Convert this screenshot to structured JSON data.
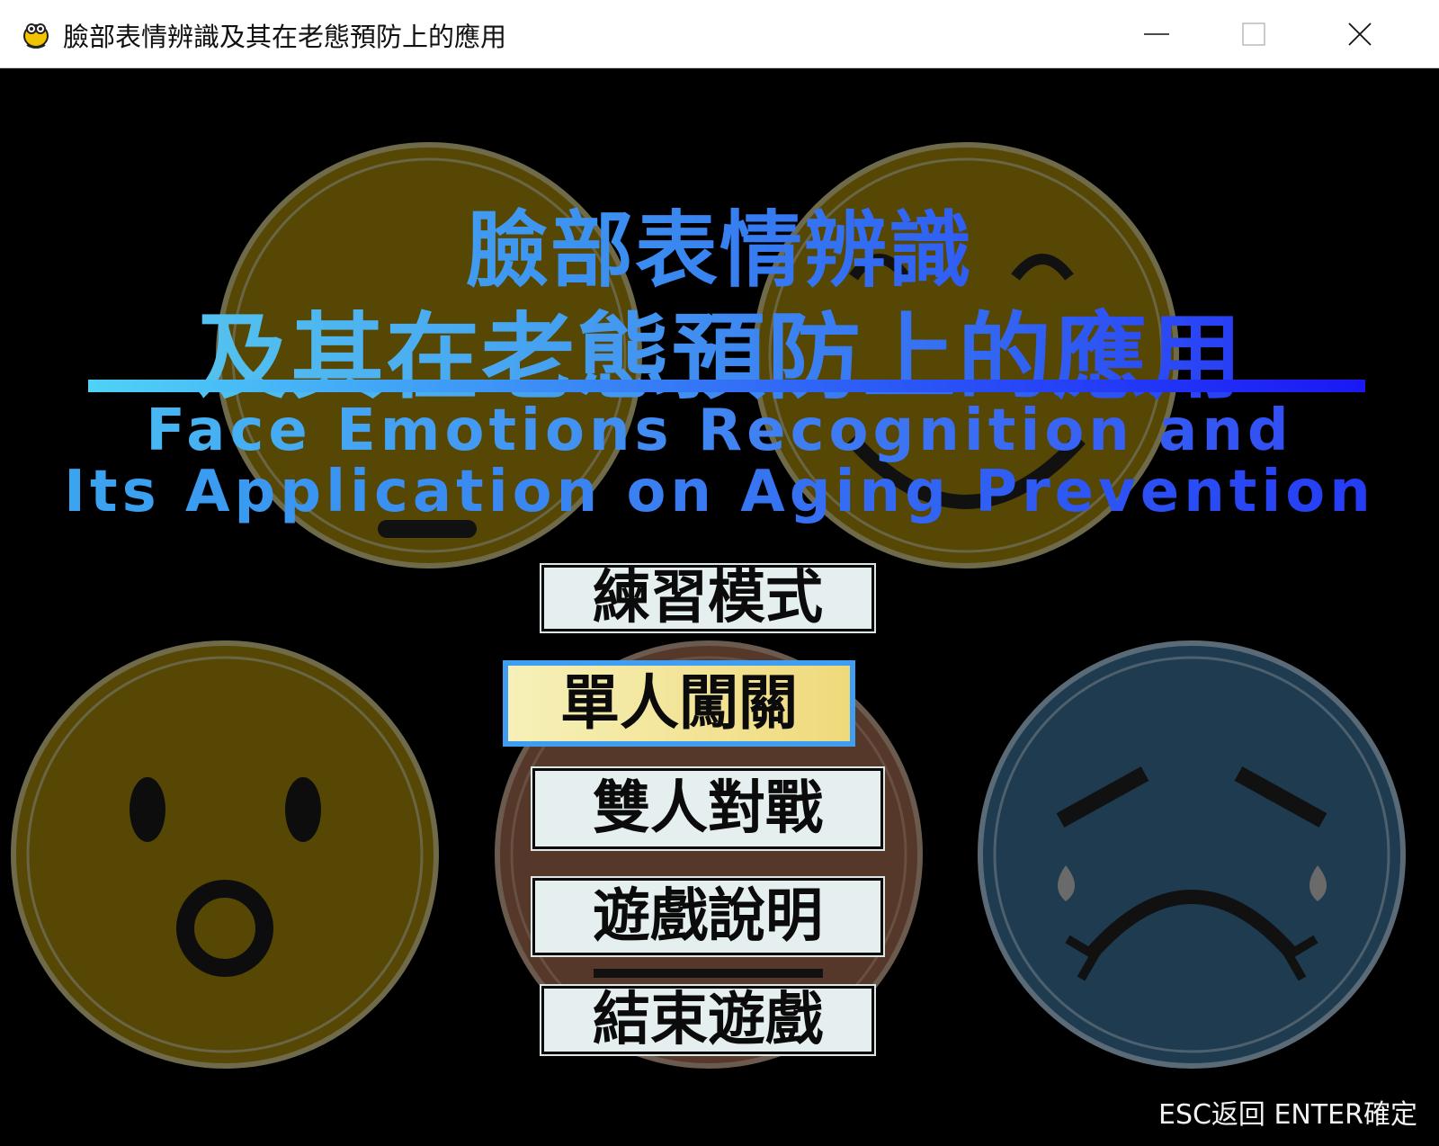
{
  "window": {
    "title": "臉部表情辨識及其在老態預防上的應用",
    "icon": "pygame-snake-icon",
    "controls": [
      "minimize",
      "maximize",
      "close"
    ]
  },
  "game": {
    "title_cn_line1": "臉部表情辨識",
    "title_cn_line2": "及其在老態預防上的應用",
    "title_en_line1": "Face Emotions Recognition and",
    "title_en_line2": "Its Application on Aging Prevention",
    "menu": [
      {
        "label": "練習模式",
        "selected": false
      },
      {
        "label": "單人闖關",
        "selected": true
      },
      {
        "label": "雙人對戰",
        "selected": false
      },
      {
        "label": "遊戲說明",
        "selected": false
      },
      {
        "label": "結束遊戲",
        "selected": false
      }
    ],
    "hint": "ESC返回 ENTER確定",
    "background_faces": [
      "neutral-face",
      "smile-face",
      "surprised-face",
      "angry-face",
      "crying-face"
    ]
  },
  "colors": {
    "yellow_face": "#5a4a06",
    "blue_face": "#1d3c52",
    "brown_face": "#5a3b2c",
    "selected_border": "#3f9ef2",
    "selected_fill": "#efd97b",
    "menu_fill": "#e6efef"
  }
}
